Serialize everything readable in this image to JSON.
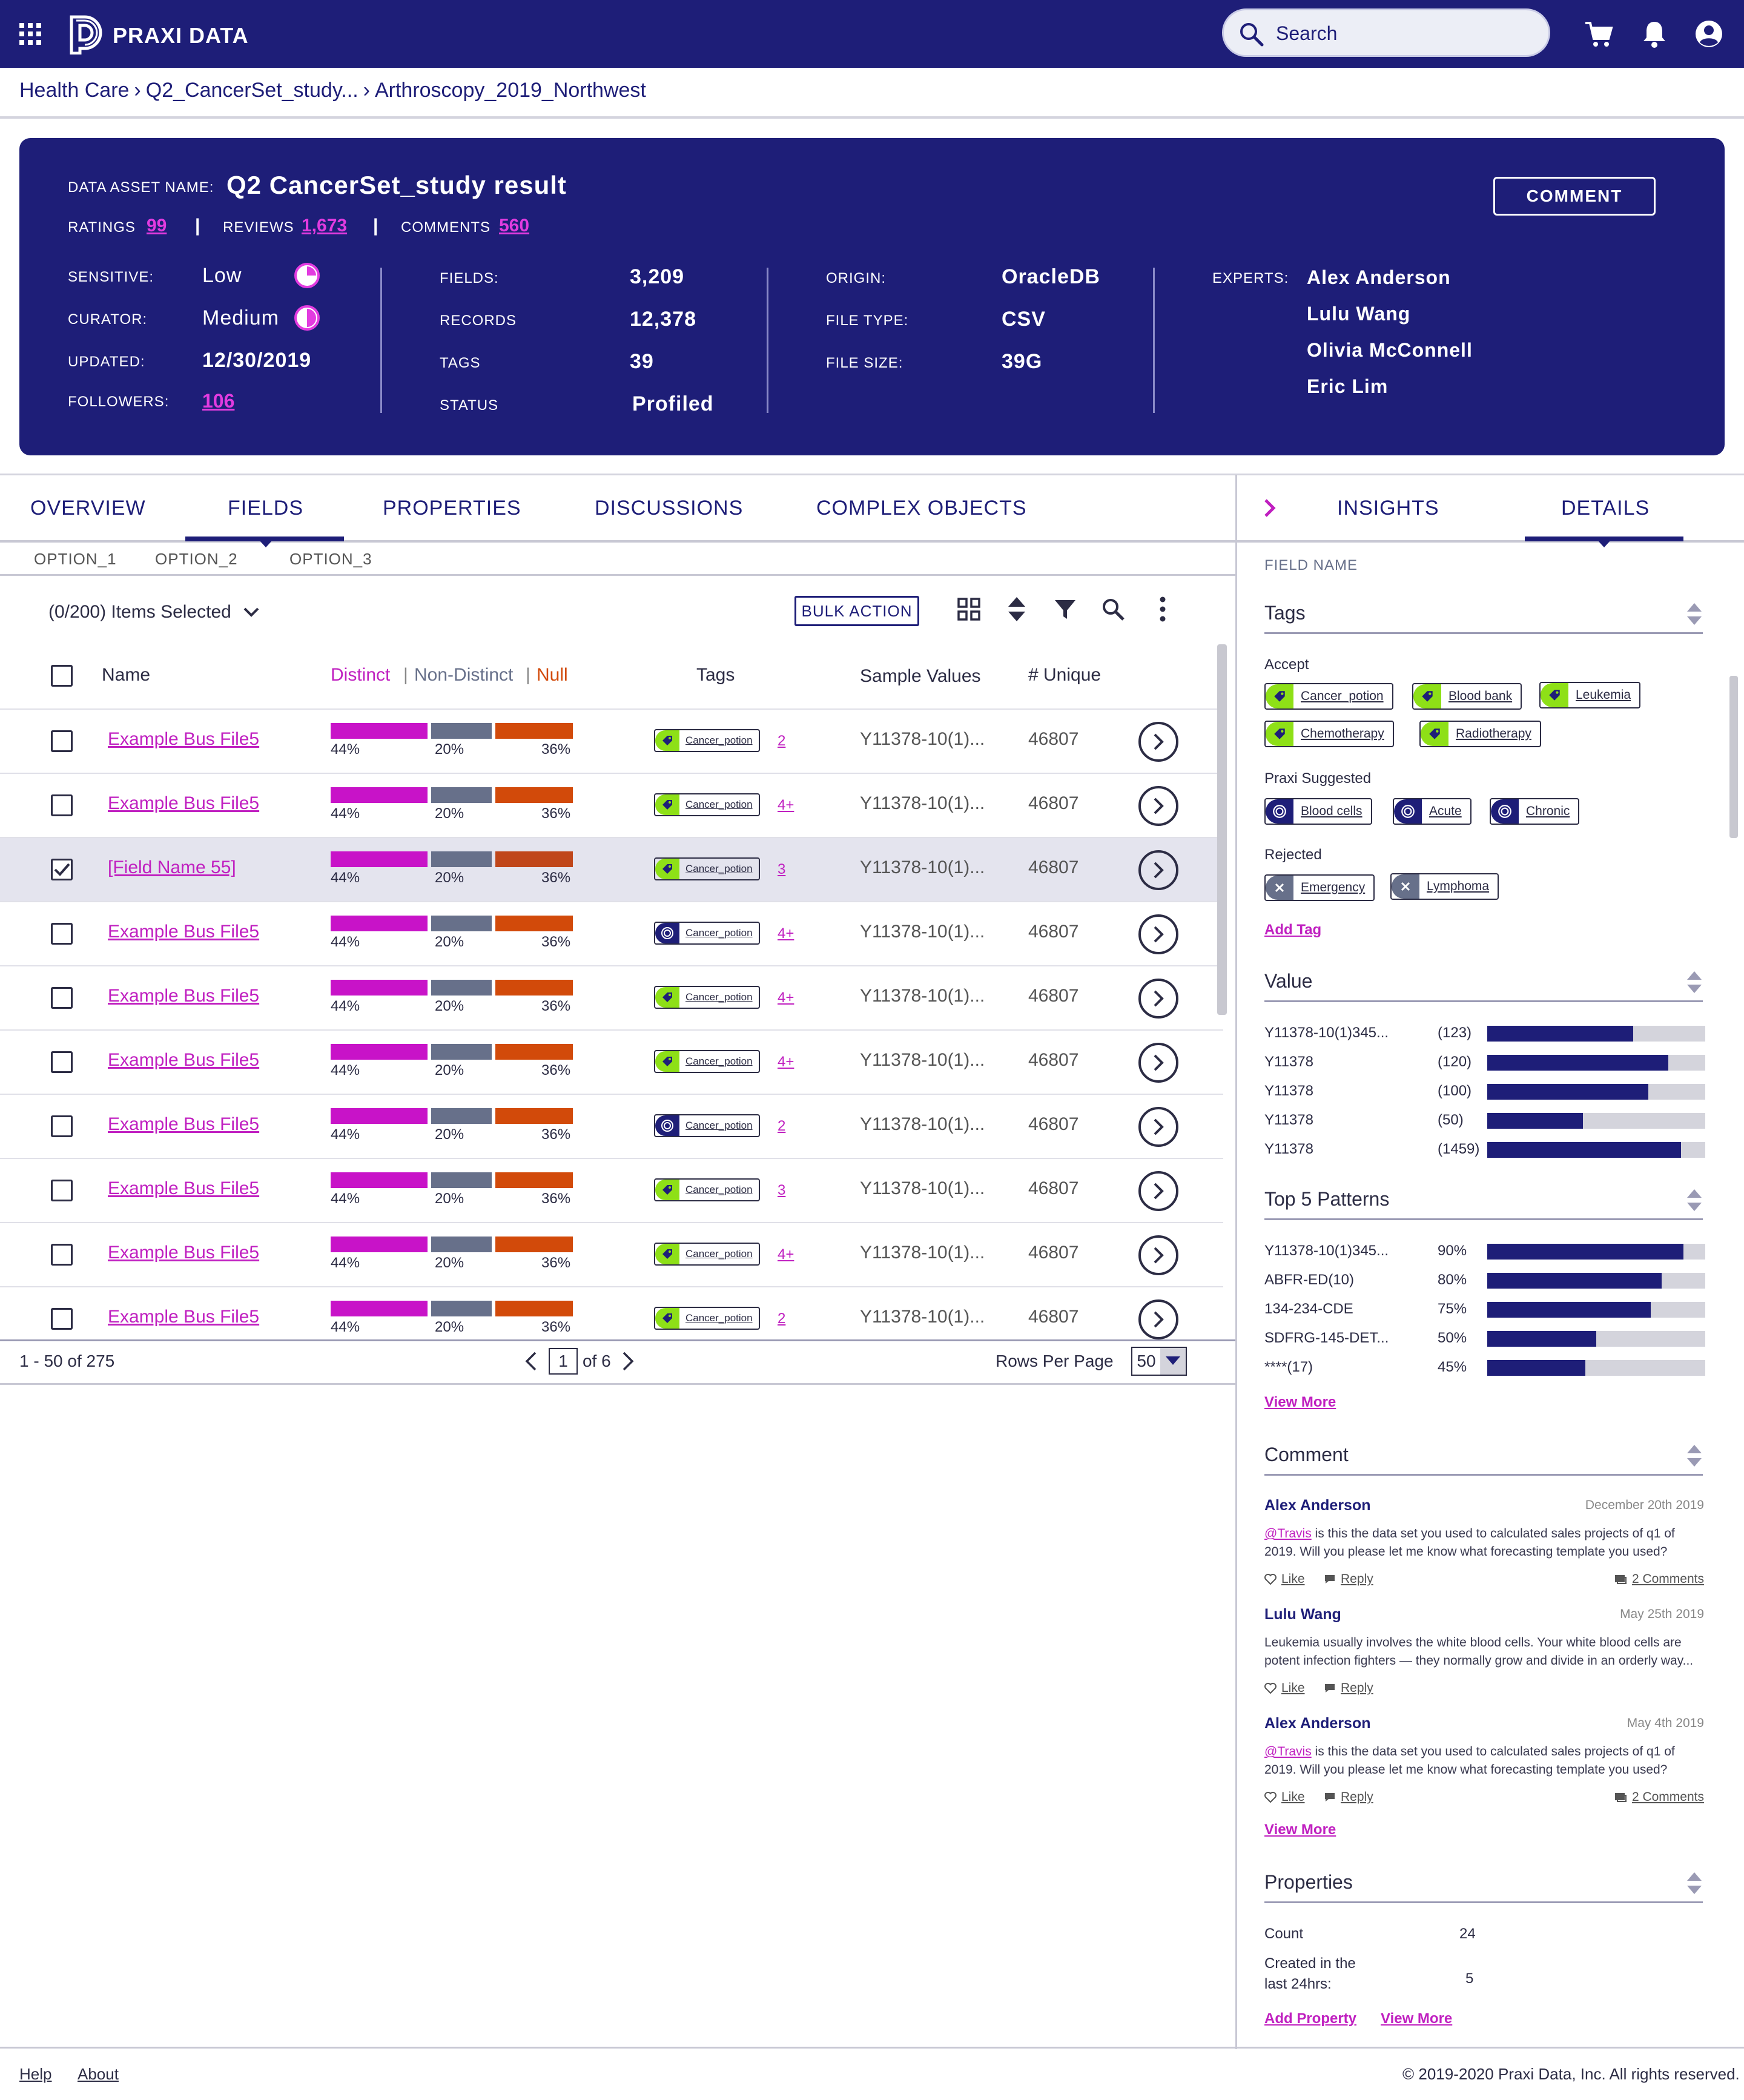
{
  "topbar": {
    "brand": "PRAXI DATA",
    "search_placeholder": "Search",
    "icons": [
      "apps-grid-icon",
      "praxi-logo",
      "search-icon",
      "cart-icon",
      "bell-icon",
      "account-icon"
    ]
  },
  "breadcrumb": {
    "items": [
      "Health Care",
      "Q2_CancerSet_study...",
      "Arthroscopy_2019_Northwest"
    ],
    "separator": "›"
  },
  "asset": {
    "name_label": "DATA ASSET NAME:",
    "name": "Q2 CancerSet_study result",
    "ratings_label": "RATINGS",
    "ratings": "99",
    "reviews_label": "REVIEWS",
    "reviews": "1,673",
    "comments_label": "COMMENTS",
    "comments": "560",
    "comment_button": "COMMENT",
    "sensitive_label": "SENSITIVE:",
    "sensitive": "Low",
    "curator_label": "CURATOR:",
    "curator": "Medium",
    "updated_label": "UPDATED:",
    "updated": "12/30/2019",
    "followers_label": "FOLLOWERS:",
    "followers": "106",
    "fields_label": "FIELDS:",
    "fields": "3,209",
    "records_label": "RECORDS",
    "records": "12,378",
    "tags_label": "TAGS",
    "tags": "39",
    "status_label": "STATUS",
    "status": "Profiled",
    "origin_label": "ORIGIN:",
    "origin": "OracleDB",
    "filetype_label": "FILE TYPE:",
    "filetype": "CSV",
    "filesize_label": "FILE SIZE:",
    "filesize": "39G",
    "experts_label": "EXPERTS:",
    "experts": [
      "Alex Anderson",
      "Lulu Wang",
      "Olivia McConnell",
      "Eric Lim"
    ]
  },
  "tabs": [
    "OVERVIEW",
    "FIELDS",
    "PROPERTIES",
    "DISCUSSIONS",
    "COMPLEX OBJECTS"
  ],
  "active_tab": "FIELDS",
  "sub_options": [
    "OPTION_1",
    "OPTION_2",
    "OPTION_3"
  ],
  "toolbar": {
    "selected": "(0/200) Items Selected",
    "bulk_action": "BULK ACTION"
  },
  "table": {
    "headers": {
      "name": "Name",
      "distinct": "Distinct",
      "non_distinct": "Non-Distinct",
      "null": "Null",
      "tags": "Tags",
      "sample": "Sample Values",
      "unique": "# Unique"
    },
    "rows": [
      {
        "name": "Example Bus File5",
        "checked": false,
        "distinct": "44%",
        "nondistinct": "20%",
        "null": "36%",
        "tag": "Cancer_potion",
        "tag_type": "green",
        "more": "2",
        "sample": "Y11378-10(1)...",
        "unique": "46807"
      },
      {
        "name": "Example Bus File5",
        "checked": false,
        "distinct": "44%",
        "nondistinct": "20%",
        "null": "36%",
        "tag": "Cancer_potion",
        "tag_type": "green",
        "more": "4+",
        "sample": "Y11378-10(1)...",
        "unique": "46807"
      },
      {
        "name": "[Field Name 55]",
        "checked": true,
        "distinct": "44%",
        "nondistinct": "20%",
        "null": "36%",
        "tag": "Cancer_potion",
        "tag_type": "green",
        "more": "3",
        "sample": "Y11378-10(1)...",
        "unique": "46807"
      },
      {
        "name": "Example Bus File5",
        "checked": false,
        "distinct": "44%",
        "nondistinct": "20%",
        "null": "36%",
        "tag": "Cancer_potion",
        "tag_type": "navy",
        "more": "4+",
        "sample": "Y11378-10(1)...",
        "unique": "46807"
      },
      {
        "name": "Example Bus File5",
        "checked": false,
        "distinct": "44%",
        "nondistinct": "20%",
        "null": "36%",
        "tag": "Cancer_potion",
        "tag_type": "green",
        "more": "4+",
        "sample": "Y11378-10(1)...",
        "unique": "46807"
      },
      {
        "name": "Example Bus File5",
        "checked": false,
        "distinct": "44%",
        "nondistinct": "20%",
        "null": "36%",
        "tag": "Cancer_potion",
        "tag_type": "green",
        "more": "4+",
        "sample": "Y11378-10(1)...",
        "unique": "46807"
      },
      {
        "name": "Example Bus File5",
        "checked": false,
        "distinct": "44%",
        "nondistinct": "20%",
        "null": "36%",
        "tag": "Cancer_potion",
        "tag_type": "navy",
        "more": "2",
        "sample": "Y11378-10(1)...",
        "unique": "46807"
      },
      {
        "name": "Example Bus File5",
        "checked": false,
        "distinct": "44%",
        "nondistinct": "20%",
        "null": "36%",
        "tag": "Cancer_potion",
        "tag_type": "green",
        "more": "3",
        "sample": "Y11378-10(1)...",
        "unique": "46807"
      },
      {
        "name": "Example Bus File5",
        "checked": false,
        "distinct": "44%",
        "nondistinct": "20%",
        "null": "36%",
        "tag": "Cancer_potion",
        "tag_type": "green",
        "more": "4+",
        "sample": "Y11378-10(1)...",
        "unique": "46807"
      },
      {
        "name": "Example Bus File5",
        "checked": false,
        "distinct": "44%",
        "nondistinct": "20%",
        "null": "36%",
        "tag": "Cancer_potion",
        "tag_type": "green",
        "more": "2",
        "sample": "Y11378-10(1)...",
        "unique": "46807"
      }
    ]
  },
  "pagination": {
    "range": "1 - 50 of 275",
    "page": "1",
    "of": "of 6",
    "rows_label": "Rows Per Page",
    "rows_value": "50"
  },
  "panel": {
    "tabs": [
      "INSIGHTS",
      "DETAILS"
    ],
    "active_tab": "DETAILS",
    "field_name_label": "FIELD NAME",
    "tags_title": "Tags",
    "accept_label": "Accept",
    "accept": [
      "Cancer_potion",
      "Blood bank",
      "Leukemia",
      "Chemotherapy",
      "Radiotherapy"
    ],
    "suggested_label": "Praxi Suggested",
    "suggested": [
      "Blood cells",
      "Acute",
      "Chronic"
    ],
    "rejected_label": "Rejected",
    "rejected": [
      "Emergency",
      "Lymphoma"
    ],
    "add_tag": "Add Tag",
    "value_title": "Value",
    "values": [
      {
        "label": "Y11378-10(1)345...",
        "count": "(123)",
        "fill": 0.67
      },
      {
        "label": "Y11378",
        "count": "(120)",
        "fill": 0.83
      },
      {
        "label": "Y11378",
        "count": "(100)",
        "fill": 0.74
      },
      {
        "label": "Y11378",
        "count": "(50)",
        "fill": 0.44
      },
      {
        "label": "Y11378",
        "count": "(1459)",
        "fill": 0.89
      }
    ],
    "patterns_title": "Top 5 Patterns",
    "patterns": [
      {
        "label": "Y11378-10(1)345...",
        "pct": "90%",
        "fill": 0.9
      },
      {
        "label": "ABFR-ED(10)",
        "pct": "80%",
        "fill": 0.8
      },
      {
        "label": "134-234-CDE",
        "pct": "75%",
        "fill": 0.75
      },
      {
        "label": "SDFRG-145-DET...",
        "pct": "50%",
        "fill": 0.5
      },
      {
        "label": "****(17)",
        "pct": "45%",
        "fill": 0.45
      }
    ],
    "view_more": "View More",
    "comment_title": "Comment",
    "comments": [
      {
        "author": "Alex Anderson",
        "date": "December 20th 2019",
        "mention": "@Travis",
        "text": " is this the data set you used to calculated sales projects of q1 of 2019. Will you please let me know what forecasting template you used?",
        "like": "Like",
        "reply": "Reply",
        "count": "2 Comments"
      },
      {
        "author": "Lulu Wang",
        "date": "May 25th 2019",
        "mention": "",
        "text": "Leukemia usually involves the white blood cells. Your white blood cells are potent infection fighters — they normally grow and divide in an orderly way...",
        "like": "Like",
        "reply": "Reply",
        "count": ""
      },
      {
        "author": "Alex Anderson",
        "date": "May 4th 2019",
        "mention": "@Travis",
        "text": " is this the data set you used to calculated sales projects of q1 of 2019. Will you please let me know what forecasting template you used?",
        "like": "Like",
        "reply": "Reply",
        "count": "2 Comments"
      }
    ],
    "properties_title": "Properties",
    "count_label": "Count",
    "count_value": "24",
    "created_label": "Created in the last 24hrs:",
    "created_value": "5",
    "add_property": "Add Property"
  },
  "footer": {
    "help": "Help",
    "about": "About",
    "copyright": "© 2019-2020 Praxi Data, Inc. All rights reserved."
  },
  "colors": {
    "navy": "#1e1e78",
    "magenta": "#c020c0",
    "gray": "#67708a",
    "orange": "#d24a0a",
    "lime": "#8ee017"
  }
}
